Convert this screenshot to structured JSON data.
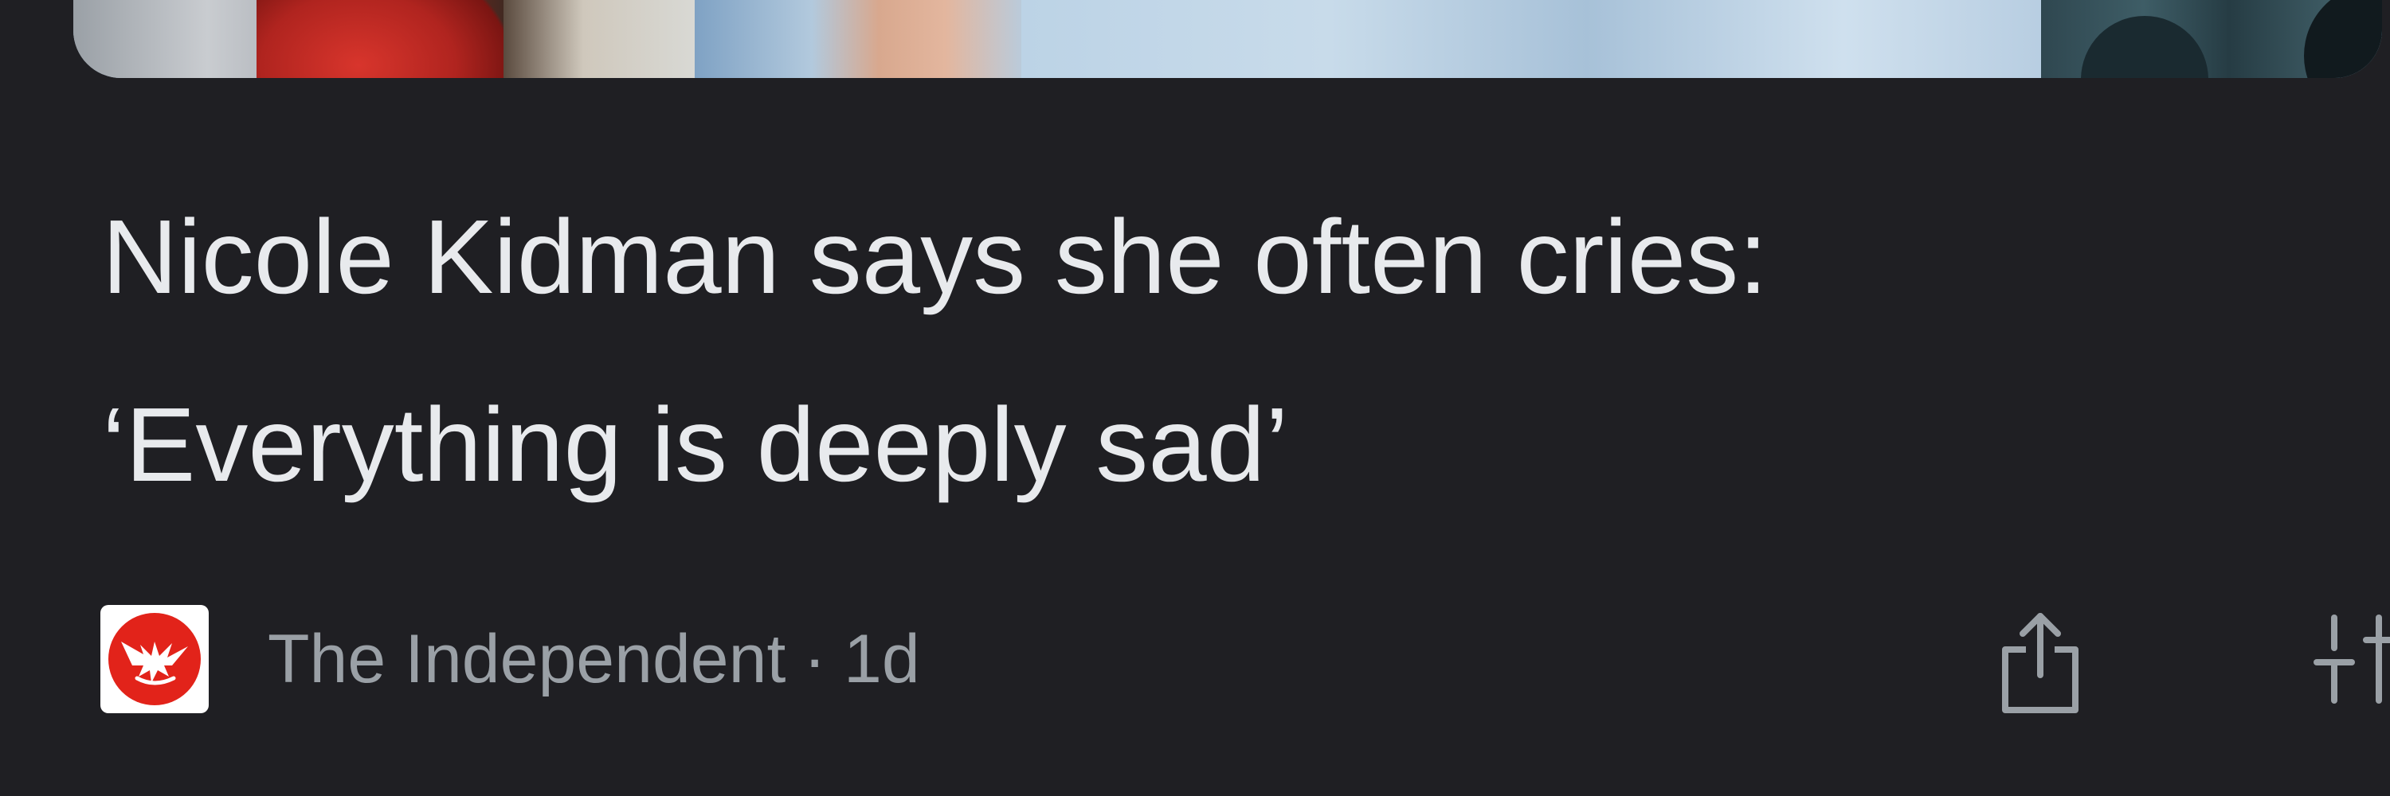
{
  "article": {
    "headline_line1": "Nicole Kidman says she often cries:",
    "headline_line2": "‘Everything is deeply sad’"
  },
  "source": {
    "name": "The Independent",
    "separator": "·",
    "age": "1d",
    "logo_icon": "independent-eagle-logo",
    "logo_color": "#e2231a"
  },
  "actions": {
    "share_icon": "share-icon",
    "more_icon": "more-options-icon"
  },
  "colors": {
    "background": "#1f1f23",
    "headline_text": "#e8eaed",
    "secondary_text": "#9aa0a6"
  }
}
